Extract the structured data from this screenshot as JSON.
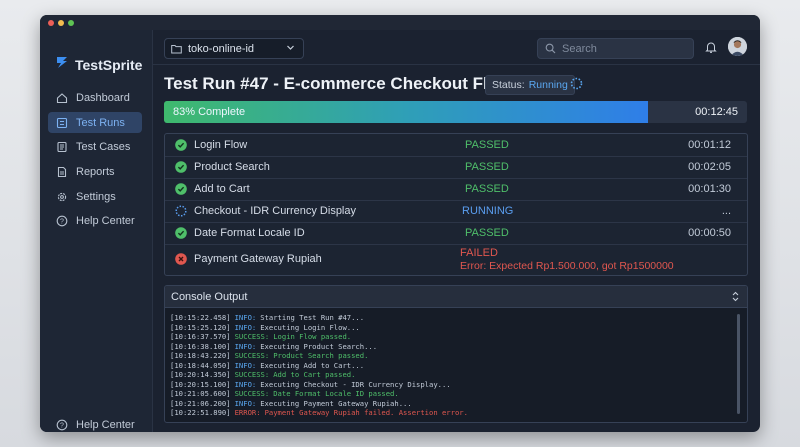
{
  "app": {
    "name": "TestSprite"
  },
  "sidebar": {
    "items": [
      {
        "label": "Dashboard",
        "icon": "home-icon",
        "active": false
      },
      {
        "label": "Test Runs",
        "icon": "test-runs-icon",
        "active": true
      },
      {
        "label": "Test Cases",
        "icon": "test-cases-icon",
        "active": false
      },
      {
        "label": "Reports",
        "icon": "reports-icon",
        "active": false
      },
      {
        "label": "Settings",
        "icon": "gear-icon",
        "active": false
      },
      {
        "label": "Help Center",
        "icon": "help-icon",
        "active": false
      }
    ],
    "footer_help": "Help Center"
  },
  "topbar": {
    "project": "toko-online-id",
    "search_placeholder": "Search"
  },
  "run": {
    "title": "Test Run #47 - E-commerce Checkout Flow",
    "status_label": "Status:",
    "status_value": "Running",
    "progress_label": "83% Complete",
    "progress_percent": 83,
    "elapsed": "00:12:45"
  },
  "tests": [
    {
      "name": "Login Flow",
      "status": "PASSED",
      "duration": "00:01:12",
      "state": "pass"
    },
    {
      "name": "Product Search",
      "status": "PASSED",
      "duration": "00:02:05",
      "state": "pass"
    },
    {
      "name": "Add to Cart",
      "status": "PASSED",
      "duration": "00:01:30",
      "state": "pass"
    },
    {
      "name": "Checkout - IDR Currency Display",
      "status": "RUNNING",
      "duration": "...",
      "state": "running"
    },
    {
      "name": "Date Format Locale ID",
      "status": "PASSED",
      "duration": "00:00:50",
      "state": "pass"
    },
    {
      "name": "Payment Gateway Rupiah",
      "status": "FAILED",
      "error": "Error: Expected Rp1.500.000, got Rp1500000",
      "duration": "",
      "state": "fail"
    }
  ],
  "console": {
    "title": "Console Output",
    "lines": [
      {
        "time": "[10:15:22.458]",
        "level": "INFO:",
        "msg": "Starting Test Run #47..."
      },
      {
        "time": "[10:15:25.120]",
        "level": "INFO:",
        "msg": "Executing Login Flow..."
      },
      {
        "time": "[10:16:37.570]",
        "level": "SUCCESS:",
        "msg": "Login Flow passed."
      },
      {
        "time": "[10:16:38.100]",
        "level": "INFO:",
        "msg": "Executing Product Search..."
      },
      {
        "time": "[10:18:43.220]",
        "level": "SUCCESS:",
        "msg": "Product Search passed."
      },
      {
        "time": "[10:18:44.050]",
        "level": "INFO:",
        "msg": "Executing Add to Cart..."
      },
      {
        "time": "[10:20:14.350]",
        "level": "SUCCESS:",
        "msg": "Add to Cart passed."
      },
      {
        "time": "[10:20:15.100]",
        "level": "INFO:",
        "msg": "Executing Checkout - IDR Currency Display..."
      },
      {
        "time": "[10:21:05.600]",
        "level": "SUCCESS:",
        "msg": "Date Format Locale ID passed."
      },
      {
        "time": "[10:21:06.200]",
        "level": "INFO:",
        "msg": "Executing Payment Gateway Rupiah..."
      },
      {
        "time": "[10:22:51.890]",
        "level": "ERROR:",
        "msg": "Payment Gateway Rupiah failed. Assertion error."
      }
    ]
  },
  "colors": {
    "pass": "#4fbf6a",
    "running": "#5a9ef0",
    "fail": "#e0574f",
    "accent": "#7db2f2"
  }
}
